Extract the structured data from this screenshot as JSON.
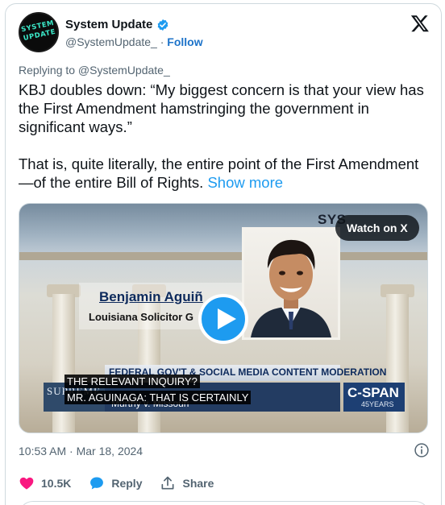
{
  "tweet": {
    "avatar_text": "SYSTEM UPDATE",
    "display_name": "System Update",
    "handle": "@SystemUpdate_",
    "separator": "·",
    "follow_label": "Follow",
    "reply_context": "Replying to @SystemUpdate_",
    "paragraph1": "KBJ doubles down: “My biggest concern is that your view has the First Amendment hamstringing the government in significant ways.”",
    "paragraph2": "That is, quite literally, the entire point of the First Amendment—of the entire Bill of Rights.",
    "show_more": "Show more",
    "timestamp": "10:53 AM · Mar 18, 2024"
  },
  "media": {
    "watch_label": "Watch on X",
    "logo_text": "SYS",
    "lower_third_name": "Benjamin Aguiñ",
    "lower_third_title": "Louisiana Solicitor G",
    "chyron": "FEDERAL GOV'T & SOCIAL MEDIA CONTENT MODERATION",
    "court_label": "SUPREME COURT",
    "case_name": "Murthy v. Missouri",
    "caption_line1": "THE RELEVANT INQUIRY?",
    "caption_line2": "MR. AGUINAGA: THAT IS CERTAINLY",
    "network": "C-SPAN",
    "network_sub": "45YEARS"
  },
  "actions": {
    "like_count": "10.5K",
    "reply_label": "Reply",
    "share_label": "Share"
  },
  "colors": {
    "accent": "#1d9bf0",
    "follow": "#1d73c9",
    "like": "#f91880",
    "muted": "#536471"
  },
  "icons": [
    "verified-badge-icon",
    "x-logo-icon",
    "play-icon",
    "heart-icon",
    "reply-bubble-icon",
    "share-icon",
    "info-icon"
  ]
}
